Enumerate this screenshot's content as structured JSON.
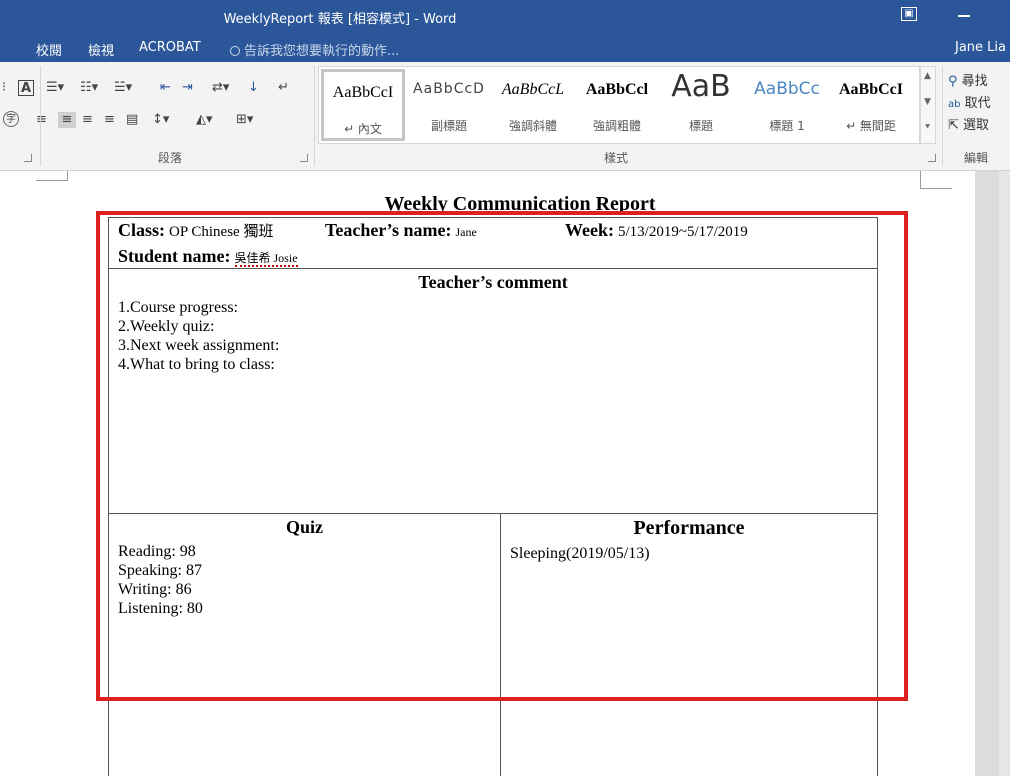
{
  "window": {
    "title": "WeeklyReport 報表 [相容模式] - Word",
    "restore_icon": "▣"
  },
  "tabs": [
    {
      "label": "校閱"
    },
    {
      "label": "檢視"
    },
    {
      "label": "ACROBAT"
    }
  ],
  "tell_me": "告訴我您想要執行的動作...",
  "user_name": "Jane Lia",
  "ribbon": {
    "paragraph_label": "段落",
    "styles_label": "樣式",
    "editing_label": "編輯",
    "styles": [
      {
        "sample": "AaBbCcI",
        "name": "↵ 內文",
        "selected": true
      },
      {
        "sample": "AaBbCcD",
        "name": "副標題"
      },
      {
        "sample": "AaBbCcL",
        "name": "強調斜體"
      },
      {
        "sample": "AaBbCcl",
        "name": "強調粗體"
      },
      {
        "sample": "AaB",
        "name": "標題"
      },
      {
        "sample": "AaBbCc",
        "name": "標題 1"
      },
      {
        "sample": "AaBbCcI",
        "name": "↵ 無間距"
      }
    ],
    "editing": [
      {
        "label": "尋找"
      },
      {
        "label": "取代"
      },
      {
        "label": "選取"
      }
    ]
  },
  "document": {
    "title": "Weekly Communication Report",
    "class_label": "Class:",
    "class_value": "OP Chinese 獨班",
    "teacher_label": "Teacher’s name:",
    "teacher_value": "Jane",
    "week_label": "Week:",
    "week_value": "5/13/2019~5/17/2019",
    "student_label": "Student name:",
    "student_value": "吳佳希 Josie",
    "comment_header": "Teacher’s comment",
    "comment_lines": [
      "1.Course progress:",
      "2.Weekly quiz:",
      "3.Next week assignment:",
      "4.What to bring to class:"
    ],
    "quiz_header": "Quiz",
    "quiz_lines": [
      "Reading: 98",
      "Speaking: 87",
      "Writing: 86",
      "Listening: 80"
    ],
    "performance_header": "Performance",
    "performance_lines": [
      "Sleeping(2019/05/13)"
    ]
  },
  "colors": {
    "title_bar": "#2b579a",
    "highlight": "#e02020"
  }
}
